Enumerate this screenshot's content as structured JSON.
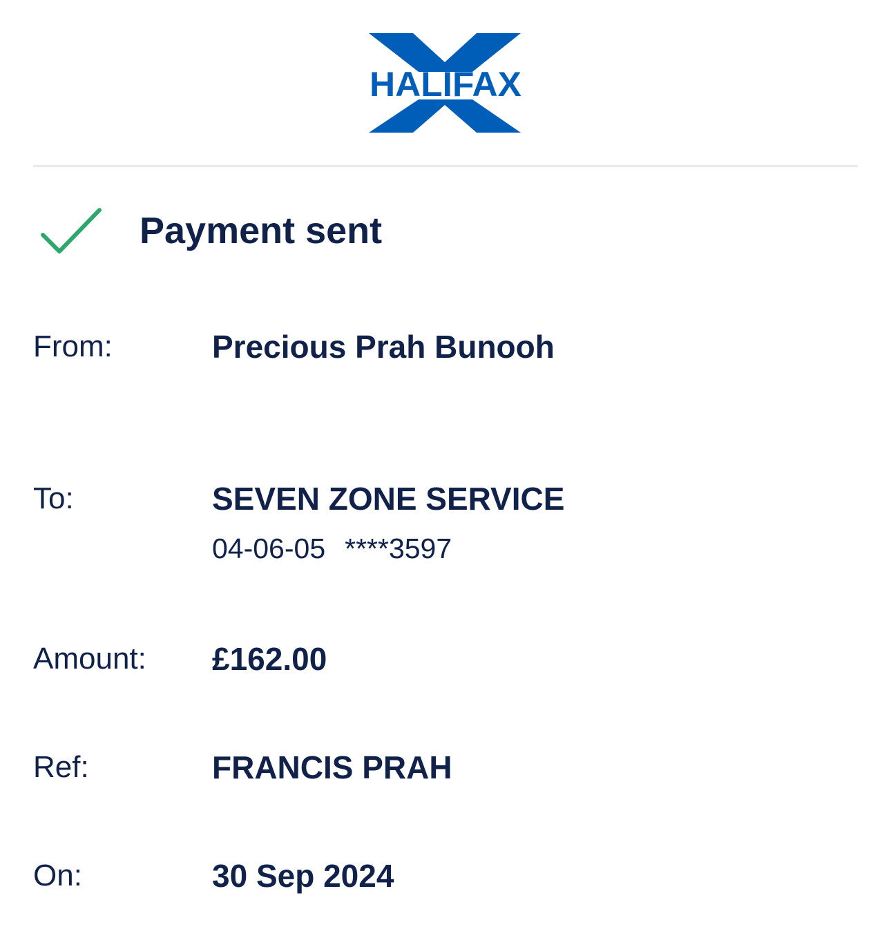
{
  "brand": {
    "name": "HALIFAX",
    "color": "#005eb8"
  },
  "status": {
    "icon": "check-icon",
    "title": "Payment sent",
    "icon_color": "#2ea86a"
  },
  "details": {
    "from": {
      "label": "From:",
      "value": "Precious Prah Bunooh"
    },
    "to": {
      "label": "To:",
      "value": "SEVEN ZONE SERVICE",
      "sort_code": "04-06-05",
      "account": "****3597"
    },
    "amount": {
      "label": "Amount:",
      "value": "£162.00"
    },
    "ref": {
      "label": "Ref:",
      "value": "FRANCIS PRAH"
    },
    "on": {
      "label": "On:",
      "value": "30 Sep 2024"
    }
  },
  "text_color": "#11224a"
}
